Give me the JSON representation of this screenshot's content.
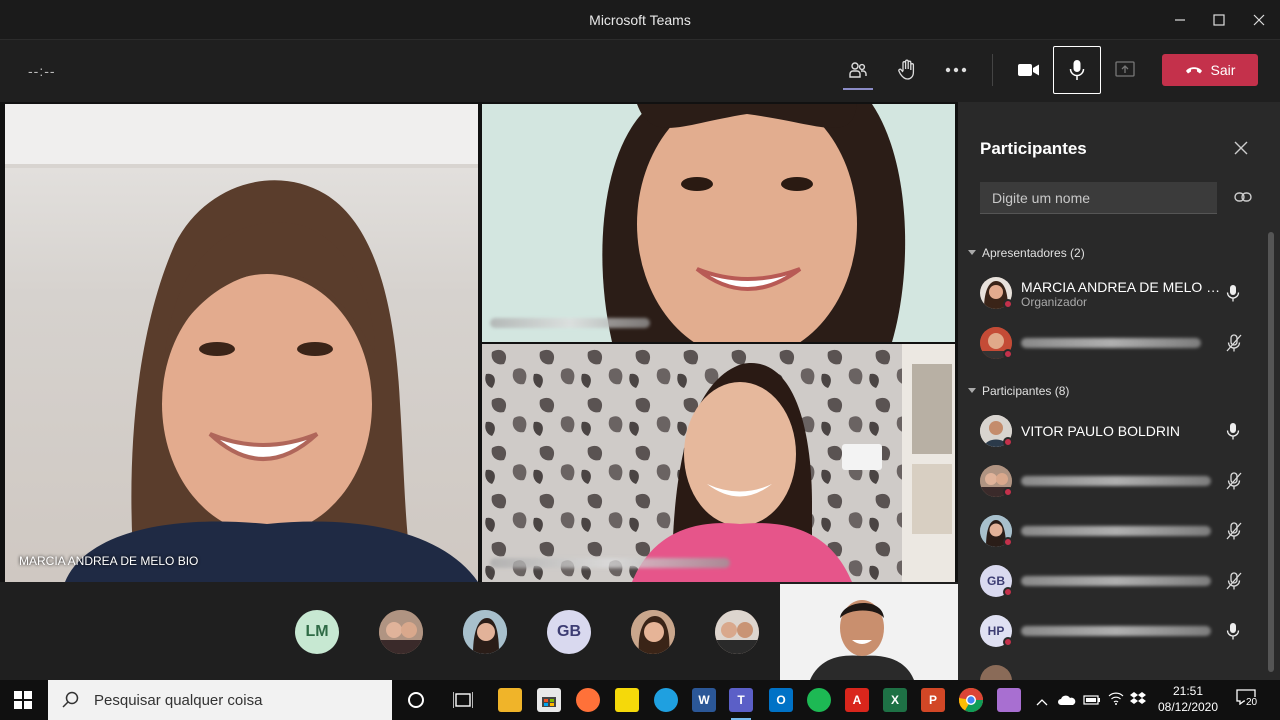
{
  "window": {
    "title": "Microsoft Teams"
  },
  "toolbar": {
    "timer": "--:--",
    "leave_label": "Sair"
  },
  "stage": {
    "tile_main_name": "MARCIA ANDREA DE MELO BIO"
  },
  "bottom_avatars": [
    {
      "initials": "LM",
      "bg": "#c7e8d2",
      "fg": "#2f6b46"
    },
    {
      "initials": "GB",
      "bg": "#d9d9ef",
      "fg": "#3d3d73"
    }
  ],
  "panel": {
    "title": "Participantes",
    "search_placeholder": "Digite um nome",
    "presenters_header": "Apresentadores (2)",
    "attendees_header": "Participantes (8)",
    "presenters": [
      {
        "name": "MARCIA ANDREA DE MELO B...",
        "role": "Organizador"
      }
    ],
    "attendees": [
      {
        "name": "VITOR PAULO BOLDRIN"
      }
    ],
    "avatar_initials": {
      "gb": "GB",
      "hp": "HP"
    }
  },
  "taskbar": {
    "search_placeholder": "Pesquisar qualquer coisa",
    "time": "21:51",
    "date": "08/12/2020",
    "notifications": "20"
  },
  "colors": {
    "leave": "#c4314b",
    "status_dot": "#c4314b",
    "accent": "#8b8cc7"
  },
  "icons": [
    "people-icon",
    "raise-hand-icon",
    "more-icon",
    "camera-icon",
    "microphone-icon",
    "share-tray-icon",
    "phone-hangup-icon",
    "close-icon",
    "link-icon",
    "mic-off-icon",
    "search-icon",
    "windows-start-icon"
  ]
}
